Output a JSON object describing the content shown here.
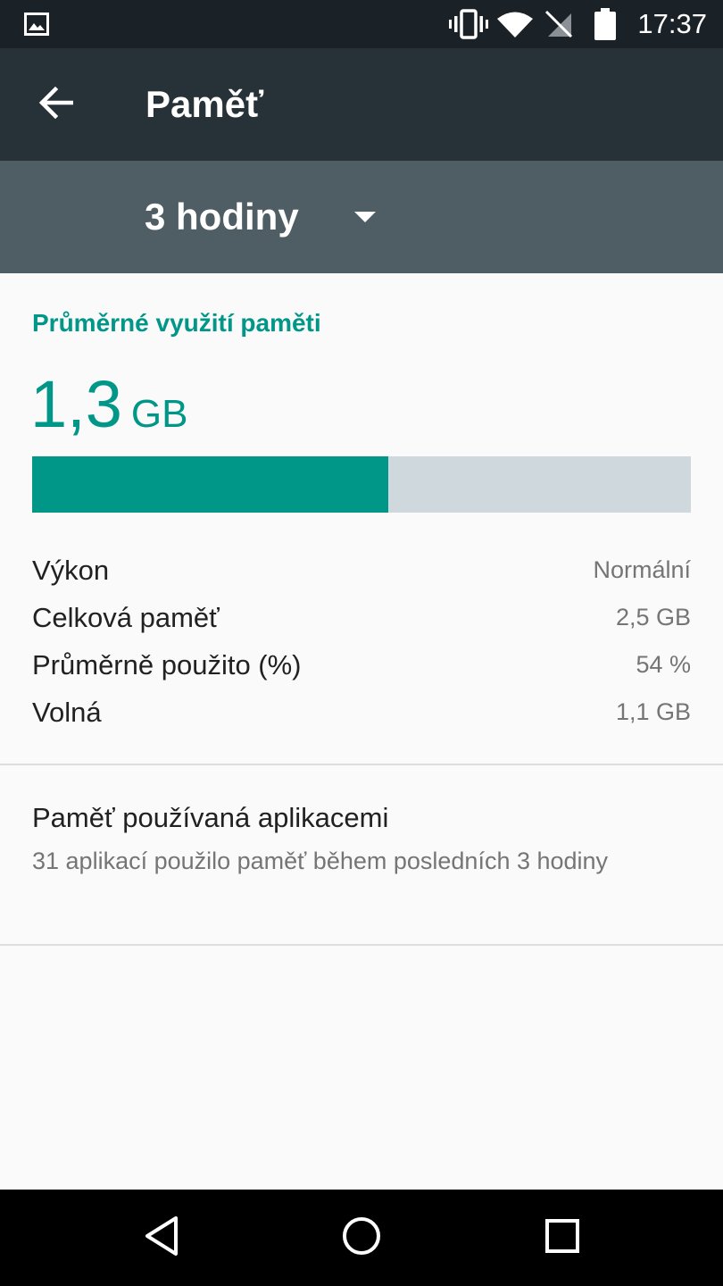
{
  "status_bar": {
    "time": "17:37",
    "icons": [
      "image-notification-icon",
      "vibrate-icon",
      "wifi-icon",
      "no-sim-icon",
      "battery-icon"
    ]
  },
  "app_bar": {
    "title": "Paměť",
    "back_icon": "arrow-back-icon"
  },
  "period": {
    "selected": "3 hodiny"
  },
  "memory": {
    "section_title": "Průměrné využití paměti",
    "average_value": "1,3",
    "average_unit": "GB",
    "usage_fraction": 0.54,
    "stats": [
      {
        "label": "Výkon",
        "value": "Normální"
      },
      {
        "label": "Celková paměť",
        "value": "2,5 GB"
      },
      {
        "label": "Průměrně použito (%)",
        "value": "54 %"
      },
      {
        "label": "Volná",
        "value": "1,1 GB"
      }
    ]
  },
  "apps": {
    "title": "Paměť používaná aplikacemi",
    "subtitle": "31 aplikací použilo paměť během posledních 3 hodiny"
  },
  "nav_bar": {
    "icons": [
      "back-triangle-icon",
      "home-circle-icon",
      "recents-square-icon"
    ]
  },
  "colors": {
    "accent": "#009688",
    "app_bar": "#263238",
    "status_bar": "#1b2227",
    "period_bar": "#4f5e65",
    "bar_track": "#cfd8dc"
  }
}
